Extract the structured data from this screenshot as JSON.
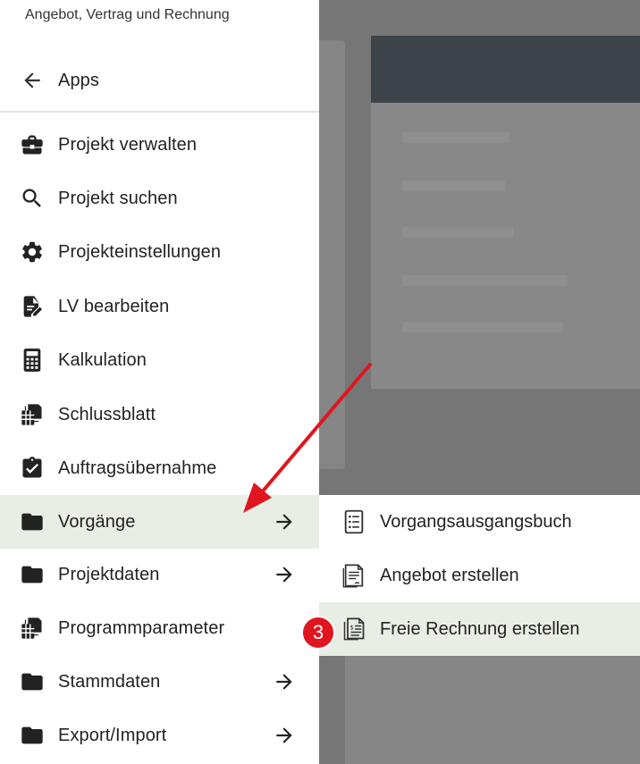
{
  "drawer": {
    "title": "Angebot, Vertrag und Rechnung",
    "back_label": "Apps",
    "items": [
      {
        "label": "Projekt verwalten",
        "icon": "briefcase-icon"
      },
      {
        "label": "Projekt suchen",
        "icon": "search-icon"
      },
      {
        "label": "Projekteinstellungen",
        "icon": "gear-icon"
      },
      {
        "label": "LV bearbeiten",
        "icon": "edit-document-icon"
      },
      {
        "label": "Kalkulation",
        "icon": "calculator-icon"
      },
      {
        "label": "Schlussblatt",
        "icon": "spreadsheet-icon"
      },
      {
        "label": "Auftragsübernahme",
        "icon": "clipboard-check-icon"
      },
      {
        "label": "Vorgänge",
        "icon": "folder-icon",
        "has_submenu": true,
        "active": true
      },
      {
        "label": "Projektdaten",
        "icon": "folder-icon",
        "has_submenu": true
      },
      {
        "label": "Programmparameter",
        "icon": "spreadsheet-icon"
      },
      {
        "label": "Stammdaten",
        "icon": "folder-icon",
        "has_submenu": true
      },
      {
        "label": "Export/Import",
        "icon": "folder-icon",
        "has_submenu": true
      }
    ]
  },
  "submenu": {
    "items": [
      {
        "label": "Vorgangsausgangsbuch",
        "icon": "list-document-icon"
      },
      {
        "label": "Angebot erstellen",
        "icon": "offer-document-icon"
      },
      {
        "label": "Freie Rechnung erstellen",
        "icon": "invoice-document-icon",
        "active": true
      }
    ]
  },
  "annotation": {
    "step_number": "3",
    "badge_color": "#e0161e",
    "arrow_color": "#e0161e"
  },
  "colors": {
    "active_row": "#e8eee4",
    "overlay": "#767676"
  }
}
